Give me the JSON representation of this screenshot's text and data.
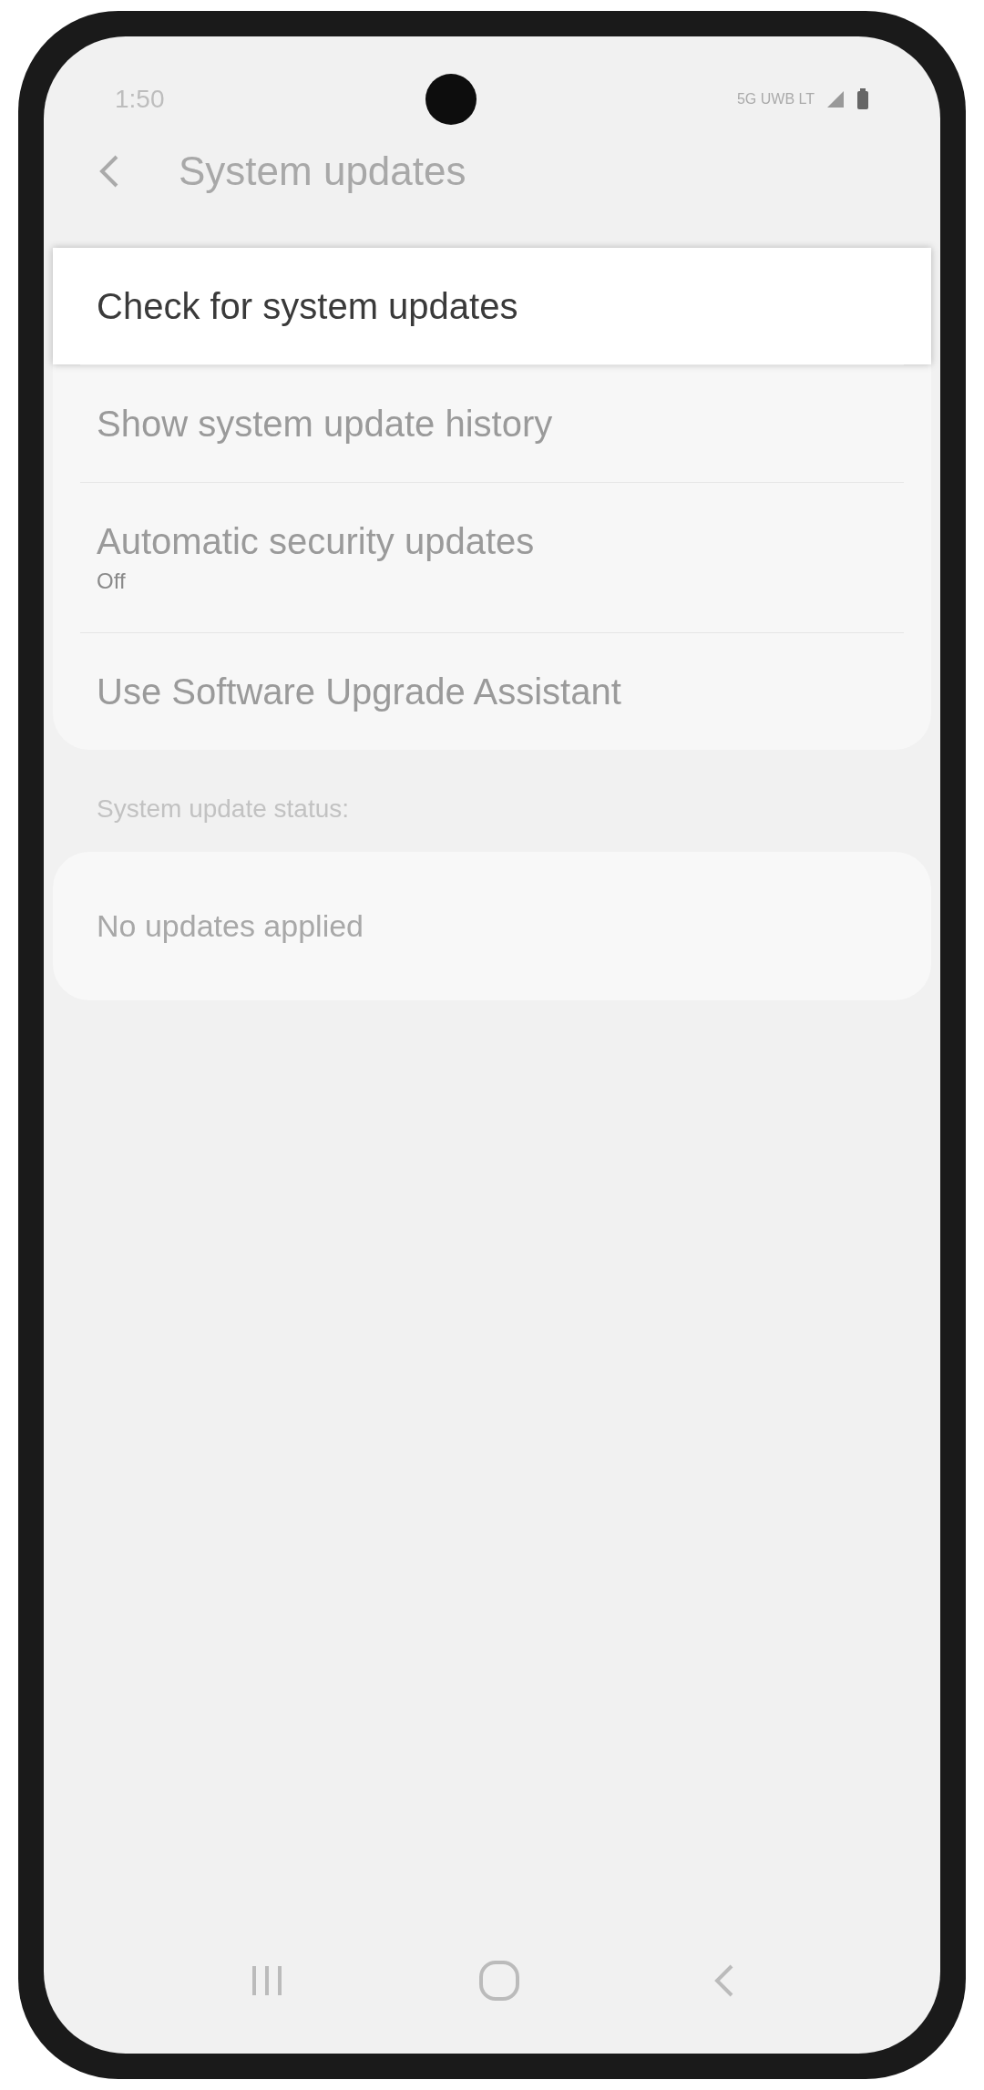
{
  "status_bar": {
    "time": "1:50",
    "network": "5G UWB LT"
  },
  "header": {
    "title": "System updates"
  },
  "menu": [
    {
      "label": "Check for system updates",
      "selected": true
    },
    {
      "label": "Show system update history",
      "selected": false
    },
    {
      "label": "Automatic security updates",
      "subtitle": "Off",
      "selected": false
    },
    {
      "label": "Use Software Upgrade Assistant",
      "selected": false
    }
  ],
  "status_section": {
    "heading": "System update status:",
    "value": "No updates applied"
  }
}
